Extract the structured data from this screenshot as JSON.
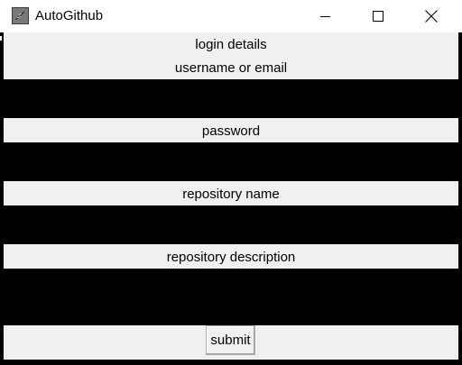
{
  "window": {
    "title": "AutoGithub",
    "app_icon": "feather-icon",
    "controls": {
      "minimize_icon": "minimize-icon",
      "maximize_icon": "maximize-icon",
      "close_icon": "close-icon"
    }
  },
  "form": {
    "heading": "login details",
    "username_label": "username or email",
    "username_value": "",
    "password_label": "password",
    "password_value": "",
    "repo_name_label": "repository name",
    "repo_name_value": "",
    "repo_description_label": "repository description",
    "repo_description_value": "",
    "submit_label": "submit"
  },
  "colors": {
    "field_background": "#000000",
    "client_background": "#f0f0f0",
    "titlebar_background": "#ffffff"
  }
}
